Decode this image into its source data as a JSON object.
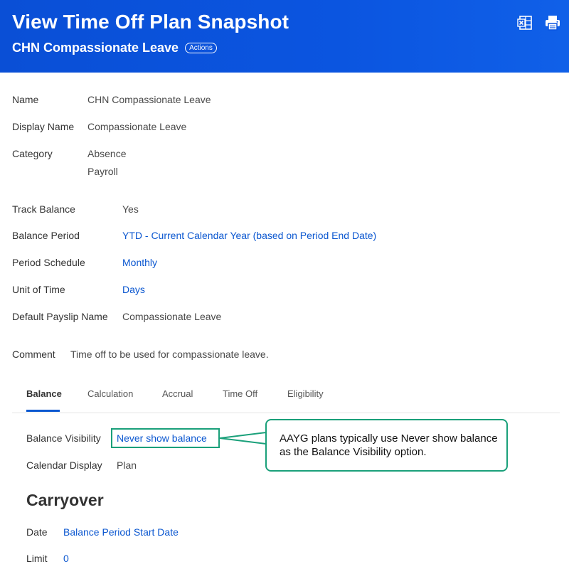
{
  "header": {
    "title": "View Time Off Plan Snapshot",
    "subtitle": "CHN Compassionate Leave",
    "actions_label": "Actions",
    "icons": [
      "export-to-excel-icon",
      "print-icon"
    ]
  },
  "plan_fields": [
    {
      "label": "Name",
      "value": "CHN Compassionate Leave"
    },
    {
      "label": "Display Name",
      "value": "Compassionate Leave"
    },
    {
      "label": "Category",
      "values": [
        "Absence",
        "Payroll"
      ]
    }
  ],
  "balance_fields": [
    {
      "label": "Track Balance",
      "value": "Yes"
    },
    {
      "label": "Balance Period",
      "value": "YTD - Current Calendar Year (based on Period End Date)"
    },
    {
      "label": "Period Schedule",
      "value": "Monthly"
    },
    {
      "label": "Unit of Time",
      "value": "Days"
    },
    {
      "label": "Default Payslip Name",
      "value": "Compassionate Leave"
    }
  ],
  "comment": {
    "label": "Comment",
    "value": "Time off to be used for compassionate leave."
  },
  "tabs": [
    "Balance",
    "Calculation",
    "Accrual",
    "Time Off",
    "Eligibility"
  ],
  "active_tab": "Balance",
  "balance_tab": {
    "visibility_label": "Balance Visibility",
    "visibility_value": "Never show balance",
    "calendar_label": "Calendar Display",
    "calendar_value": "Plan"
  },
  "callout": {
    "text": "AAYG plans typically use Never show balance as the Balance Visibility option."
  },
  "carryover": {
    "heading": "Carryover",
    "date_label": "Date",
    "date_value": "Balance Period Start Date",
    "limit_label": "Limit",
    "limit_value": "0"
  },
  "colors": {
    "header_blue": "#0b55e0",
    "link_blue": "#0b57d0",
    "highlight_green": "#1aa07a"
  }
}
